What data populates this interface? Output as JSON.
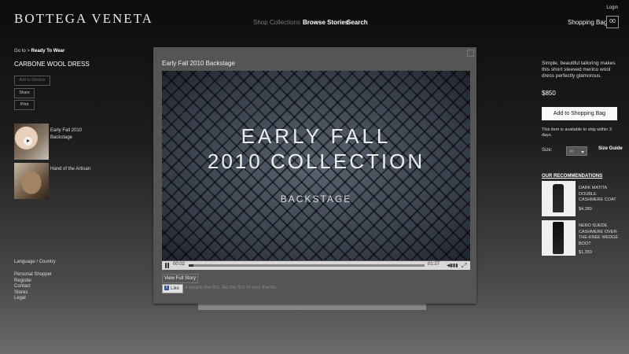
{
  "header": {
    "logo": "BOTTEGA VENETA",
    "nav": [
      "Shop Collections",
      "Browse Stories",
      "Search"
    ],
    "login": "Login",
    "shopping_bag": "Shopping Bag",
    "bag_count": "00"
  },
  "left": {
    "goto_prefix": "Go to >",
    "goto_link": "Ready To Wear",
    "product_title": "CARBONE WOOL DRESS",
    "buttons": {
      "wishlist": "Add to Wishlist",
      "share": "Share",
      "print": "Print"
    },
    "stories": [
      {
        "label": "Early Fall 2010 Backstage"
      },
      {
        "label": "Hand of the Artisan"
      }
    ],
    "language": "Language / Country",
    "footer_links": [
      "Personal Shopper",
      "Register",
      "Contact",
      "Stores",
      "Legal"
    ]
  },
  "modal": {
    "title": "Early Fall 2010 Backstage",
    "video_line1": "EARLY FALL",
    "video_line2": "2010 COLLECTION",
    "video_line3": "BACKSTAGE",
    "current_time": "00:02",
    "duration": "01:27",
    "progress": 0.02,
    "view_full": "View Full Story",
    "like": "Like",
    "like_text": "4 people like this. Be the first of your friends."
  },
  "right": {
    "description": "Simple, beautiful tailoring makes this short sleeved merino wool dress perfectly glamorous.",
    "price": "$850",
    "add_to_bag": "Add to Shopping Bag",
    "ship_note": "This item is available to ship within 3 days.",
    "size_label": "Size:",
    "size_value": "40",
    "size_guide": "Size Guide",
    "recommendations_title": "OUR RECOMMENDATIONS",
    "recommendations": [
      {
        "name": "DARK MATITA DOUBLE CASHMERE COAT",
        "price": "$4,380"
      },
      {
        "name": "NERO SUEDE CASHMERE OVER-THE-KNEE WEDGE BOOT",
        "price": "$1,350"
      }
    ]
  }
}
